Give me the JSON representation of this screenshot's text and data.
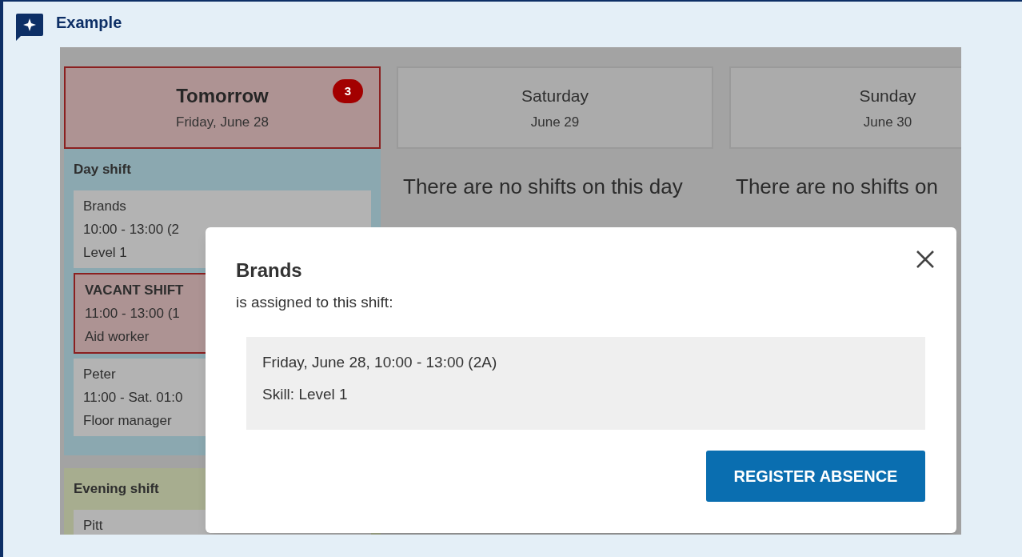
{
  "callout": {
    "title": "Example"
  },
  "days": [
    {
      "title": "Tomorrow",
      "date": "Friday, June 28",
      "highlighted": true,
      "badge": "3",
      "groups": [
        {
          "name": "Day shift",
          "color": "#8ba8b0",
          "shifts": [
            {
              "lines": [
                "Brands",
                "10:00 - 13:00 (2",
                "Level 1"
              ],
              "vacant": false
            },
            {
              "lines": [
                "VACANT SHIFT",
                "11:00 - 13:00 (1",
                "Aid worker"
              ],
              "vacant": true
            },
            {
              "lines": [
                "Peter",
                "11:00 - Sat. 01:0",
                "Floor manager"
              ],
              "vacant": false
            }
          ]
        },
        {
          "name": "Evening shift",
          "color": "#a7ad8f",
          "shifts": [
            {
              "lines": [
                "Pitt"
              ],
              "vacant": false
            }
          ]
        }
      ]
    },
    {
      "title": "Saturday",
      "date": "June 29",
      "highlighted": false,
      "empty_message": "There are no shifts on this day"
    },
    {
      "title": "Sunday",
      "date": "June 30",
      "highlighted": false,
      "empty_message": "There are no shifts on"
    }
  ],
  "dialog": {
    "title": "Brands",
    "subtitle": "is assigned to this shift:",
    "details": [
      "Friday, June 28, 10:00 - 13:00 (2A)",
      "Skill: Level 1"
    ],
    "button": "REGISTER ABSENCE"
  }
}
